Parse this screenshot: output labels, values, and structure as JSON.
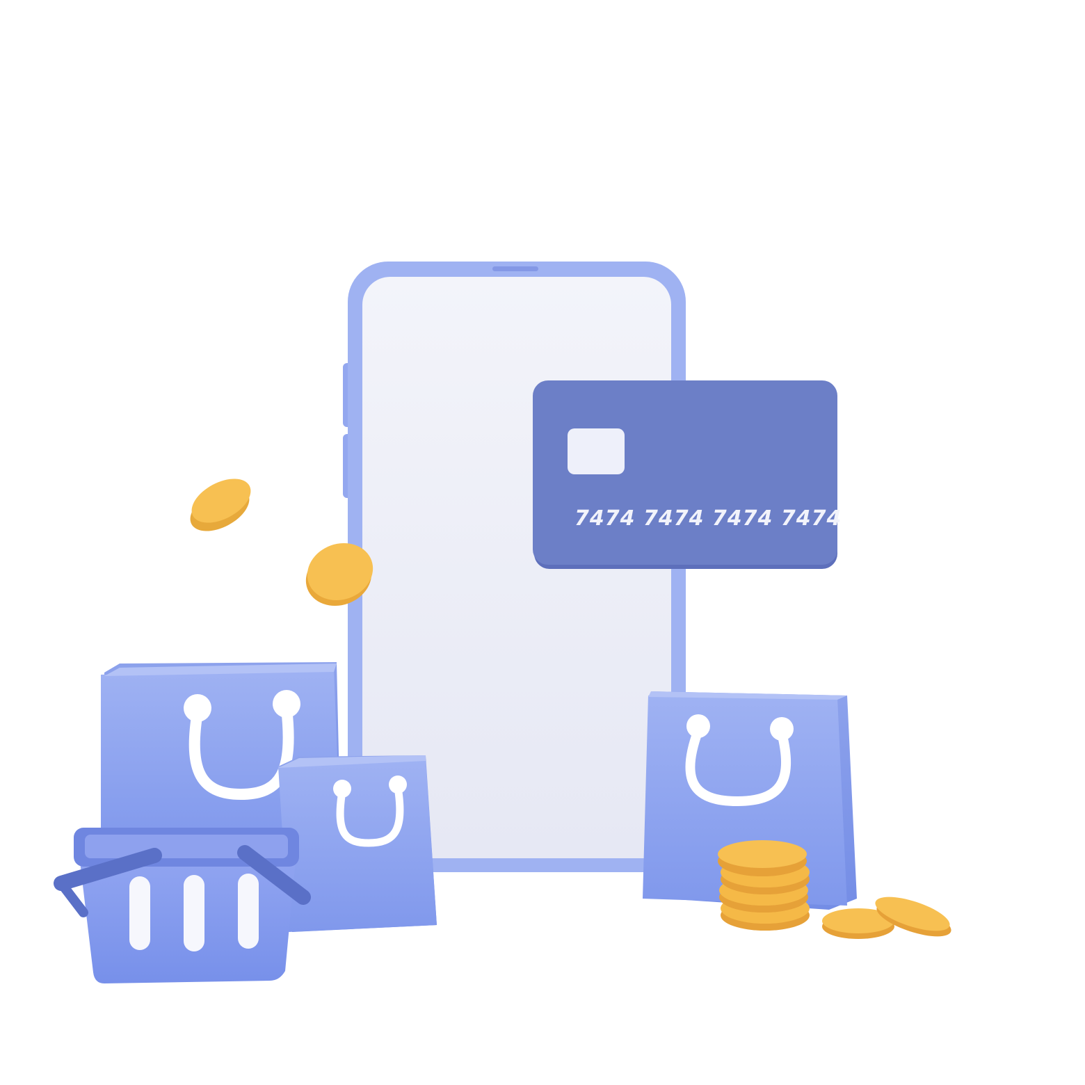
{
  "illustration": {
    "subject": "mobile shopping payment",
    "colors": {
      "phone_frame": "#a3b4f2",
      "phone_screen": "#eceef7",
      "card": "#6c7fc7",
      "bag": "#93a8f0",
      "basket": "#8299ec",
      "coin": "#f7c052",
      "handle": "#ffffff"
    }
  },
  "card": {
    "number": "7474 7474 7474 7474"
  }
}
